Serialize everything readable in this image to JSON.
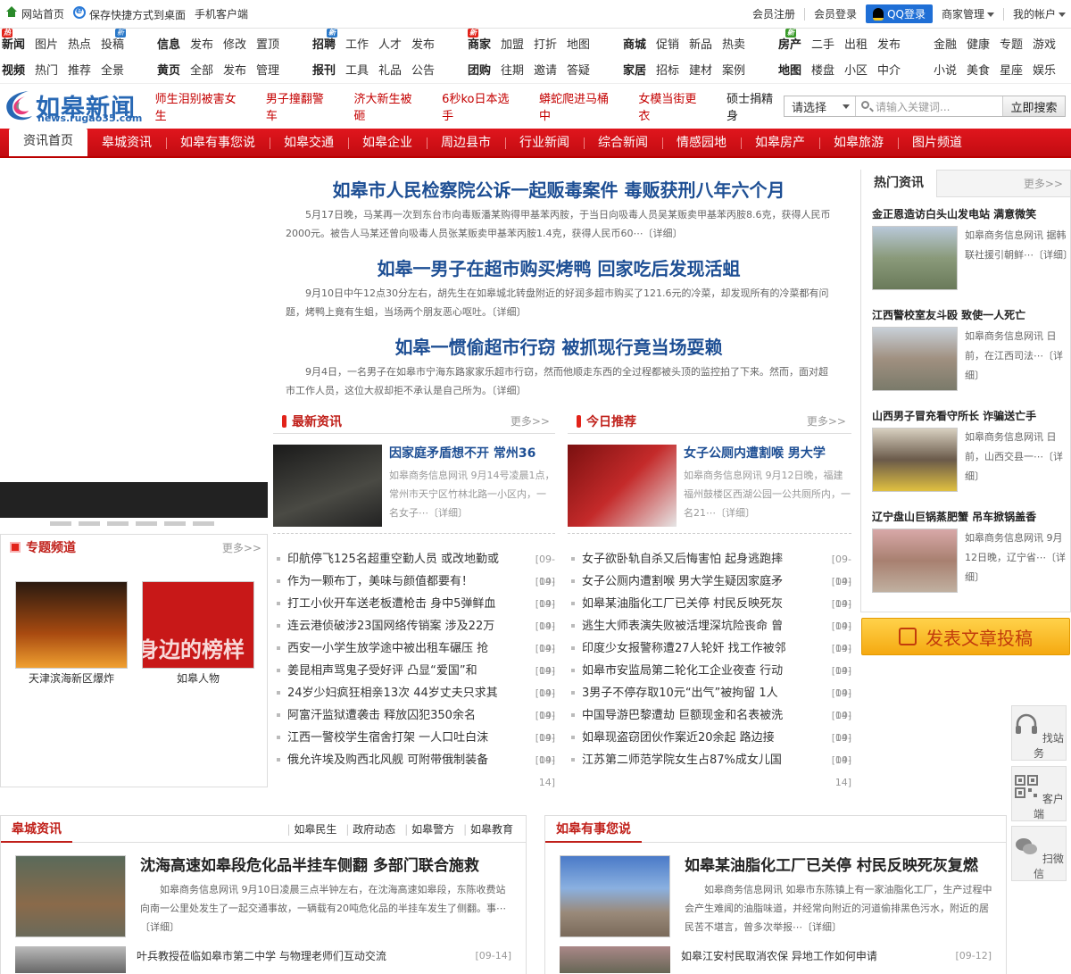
{
  "topbar": {
    "left": [
      "网站首页",
      "保存快捷方式到桌面",
      "手机客户端"
    ],
    "right": [
      "会员注册",
      "会员登录",
      "QQ登录",
      "商家管理",
      "我的帐户"
    ]
  },
  "nav": {
    "groups": [
      {
        "cols": 4,
        "items": [
          {
            "t": "新闻",
            "b": true,
            "badge": "热"
          },
          {
            "t": "图片"
          },
          {
            "t": "热点"
          },
          {
            "t": "投稿",
            "badge": "新",
            "badgeColor": "blue"
          },
          {
            "t": "视频",
            "b": true
          },
          {
            "t": "热门"
          },
          {
            "t": "推荐"
          },
          {
            "t": "全景"
          }
        ]
      },
      {
        "cols": 4,
        "items": [
          {
            "t": "信息",
            "b": true
          },
          {
            "t": "发布"
          },
          {
            "t": "修改"
          },
          {
            "t": "置顶"
          },
          {
            "t": "黄页",
            "b": true
          },
          {
            "t": "全部"
          },
          {
            "t": "发布"
          },
          {
            "t": "管理"
          }
        ]
      },
      {
        "cols": 4,
        "items": [
          {
            "t": "招聘",
            "b": true,
            "badge": "新",
            "badgeColor": "blue"
          },
          {
            "t": "工作"
          },
          {
            "t": "人才"
          },
          {
            "t": "发布"
          },
          {
            "t": "报刊",
            "b": true
          },
          {
            "t": "工具"
          },
          {
            "t": "礼品"
          },
          {
            "t": "公告"
          }
        ]
      },
      {
        "cols": 4,
        "items": [
          {
            "t": "商家",
            "b": true,
            "badge": "新"
          },
          {
            "t": "加盟"
          },
          {
            "t": "打折"
          },
          {
            "t": "地图"
          },
          {
            "t": "团购",
            "b": true
          },
          {
            "t": "往期"
          },
          {
            "t": "邀请"
          },
          {
            "t": "答疑"
          }
        ]
      },
      {
        "cols": 4,
        "items": [
          {
            "t": "商城",
            "b": true
          },
          {
            "t": "促销"
          },
          {
            "t": "新品"
          },
          {
            "t": "热卖"
          },
          {
            "t": "家居",
            "b": true
          },
          {
            "t": "招标"
          },
          {
            "t": "建材"
          },
          {
            "t": "案例"
          }
        ]
      },
      {
        "cols": 4,
        "items": [
          {
            "t": "房产",
            "b": true,
            "badge": "新",
            "badgeColor": "green"
          },
          {
            "t": "二手"
          },
          {
            "t": "出租"
          },
          {
            "t": "发布"
          },
          {
            "t": "地图",
            "b": true
          },
          {
            "t": "楼盘"
          },
          {
            "t": "小区"
          },
          {
            "t": "中介"
          }
        ]
      },
      {
        "cols": 4,
        "items": [
          {
            "t": "金融"
          },
          {
            "t": "健康"
          },
          {
            "t": "专题"
          },
          {
            "t": "游戏"
          },
          {
            "t": "小说"
          },
          {
            "t": "美食"
          },
          {
            "t": "星座"
          },
          {
            "t": "娱乐"
          }
        ]
      }
    ]
  },
  "logo": {
    "name": "如皋新闻",
    "url": "news.rugao35.com"
  },
  "hotlinks": [
    {
      "t": "师生泪别被害女生"
    },
    {
      "t": "男子撞翻警车"
    },
    {
      "t": "济大新生被砸"
    },
    {
      "t": "6秒ko日本选手"
    },
    {
      "t": "蟒蛇爬进马桶中"
    },
    {
      "t": "女模当街更衣"
    },
    {
      "t": "硕士捐精身",
      "dark": true
    }
  ],
  "search": {
    "select": "请选择",
    "placeholder": "请输入关键词...",
    "button": "立即搜索"
  },
  "channels": [
    "资讯首页",
    "皋城资讯",
    "如皋有事您说",
    "如皋交通",
    "如皋企业",
    "周边县市",
    "行业新闻",
    "综合新闻",
    "情感园地",
    "如皋房产",
    "如皋旅游",
    "图片频道"
  ],
  "headlines": [
    {
      "title": "如皋市人民检察院公诉一起贩毒案件 毒贩获刑八年六个月",
      "summary": "5月17日晚，马某再一次到东台市向毒贩潘某购得甲基苯丙胺，于当日向吸毒人员吴某贩卖甲基苯丙胺8.6克，获得人民币2000元。被告人马某还曾向吸毒人员张某贩卖甲基苯丙胺1.4克，获得人民币60⋯〔详细〕"
    },
    {
      "title": "如皋一男子在超市购买烤鸭 回家吃后发现活蛆",
      "summary": "9月10日中午12点30分左右，胡先生在如皋城北转盘附近的好润多超市购买了121.6元的冷菜，却发现所有的冷菜都有问题，烤鸭上竟有生蛆，当场两个朋友恶心呕吐。〔详细〕"
    },
    {
      "title": "如皋一惯偷超市行窃 被抓现行竟当场耍赖",
      "summary": "9月4日，一名男子在如皋市宁海东路家家乐超市行窃，然而他顺走东西的全过程都被头顶的监控拍了下来。然而，面对超市工作人员，这位大叔却拒不承认是自己所为。〔详细〕"
    }
  ],
  "latest": {
    "title": "最新资讯",
    "more": "更多>>",
    "feature": {
      "title": "因家庭矛盾想不开 常州36",
      "summary": "如皋商务信息网讯 9月14号凌晨1点，常州市天宁区竹林北路一小区内，一名女子⋯〔详细〕"
    },
    "items": [
      {
        "t": "印航停飞125名超重空勤人员 或改地勤或",
        "d": "[09-14]"
      },
      {
        "t": "作为一颗布丁，美味与颜值都要有！",
        "d": "[09-14]"
      },
      {
        "t": "打工小伙开车送老板遭枪击 身中5弹鲜血",
        "d": "[09-14]"
      },
      {
        "t": "连云港侦破涉23国网络传销案 涉及22万",
        "d": "[09-14]"
      },
      {
        "t": "西安一小学生放学途中被出租车碾压 抢",
        "d": "[09-14]"
      },
      {
        "t": "姜昆相声骂鬼子受好评 凸显“爱国”和",
        "d": "[09-14]"
      },
      {
        "t": "24岁少妇疯狂相亲13次 44岁丈夫只求其",
        "d": "[09-14]"
      },
      {
        "t": "阿富汗监狱遭袭击 释放囚犯350余名",
        "d": "[09-14]"
      },
      {
        "t": "江西一警校学生宿舍打架 一人口吐白沫",
        "d": "[09-14]"
      },
      {
        "t": "俄允许埃及购西北风舰 可附带俄制装备",
        "d": "[09-14]"
      }
    ]
  },
  "today": {
    "title": "今日推荐",
    "more": "更多>>",
    "feature": {
      "title": "女子公厕内遭割喉 男大学",
      "summary": "如皋商务信息网讯 9月12日晚，福建福州鼓楼区西湖公园一公共厕所内，一名21⋯〔详细〕"
    },
    "items": [
      {
        "t": "女子欲卧轨自杀又后悔害怕 起身逃跑摔",
        "d": "[09-14]"
      },
      {
        "t": "女子公厕内遭割喉 男大学生疑因家庭矛",
        "d": "[09-14]"
      },
      {
        "t": "如皋某油脂化工厂已关停 村民反映死灰",
        "d": "[09-14]"
      },
      {
        "t": "逃生大师表演失败被活埋深坑险丧命 曾",
        "d": "[09-14]"
      },
      {
        "t": "印度少女报警称遭27人轮奸 找工作被邻",
        "d": "[09-14]"
      },
      {
        "t": "如皋市安监局第二轮化工企业夜查 行动",
        "d": "[09-14]"
      },
      {
        "t": "3男子不停存取10元“出气”被拘留 1人",
        "d": "[09-14]"
      },
      {
        "t": "中国导游巴黎遭劫 巨额现金和名表被洗",
        "d": "[09-14]"
      },
      {
        "t": "如皋现盗窃团伙作案近20余起  路边接",
        "d": "[09-14]"
      },
      {
        "t": "江苏第二师范学院女生占87%成女儿国",
        "d": "[09-14]"
      }
    ]
  },
  "topics": {
    "title": "专题频道",
    "more": "更多>>",
    "cards": [
      {
        "label": "天津滨海新区爆炸"
      },
      {
        "label": "如皋人物",
        "overlay": "身边的榜样"
      }
    ]
  },
  "hot": {
    "title": "热门资讯",
    "more": "更多>>",
    "items": [
      {
        "title": "金正恩造访白头山发电站 满意微笑",
        "summary": "如皋商务信息网讯 据韩联社援引朝鲜⋯〔详细〕"
      },
      {
        "title": "江西警校室友斗殴 致使一人死亡",
        "summary": "如皋商务信息网讯 日前，在江西司法⋯〔详细〕"
      },
      {
        "title": "山西男子冒充看守所长 诈骗送亡手",
        "summary": "如皋商务信息网讯 日前，山西交县一⋯〔详细〕"
      },
      {
        "title": "辽宁盘山巨锅蒸肥蟹 吊车掀锅盖香",
        "summary": "如皋商务信息网讯 9月12日晚，辽宁省⋯〔详细〕"
      }
    ]
  },
  "post_button": "发表文章投稿",
  "floats": [
    {
      "label": "找站务"
    },
    {
      "label": "客户端"
    },
    {
      "label": "扫微信"
    }
  ],
  "gaocheng": {
    "title": "皋城资讯",
    "tabs": [
      "如皋民生",
      "政府动态",
      "如皋警方",
      "如皋教育"
    ],
    "feature": {
      "title": "沈海高速如皋段危化品半挂车侧翻 多部门联合施救",
      "summary": "如皋商务信息网讯 9月10日凌晨三点半钟左右，在沈海高速如皋段，东陈收费站向南一公里处发生了一起交通事故，一辆载有20吨危化品的半挂车发生了侧翻。事⋯〔详细〕"
    },
    "list": [
      {
        "t": "叶兵教授莅临如皋市第二中学 与物理老师们互动交流",
        "d": "[09-14]"
      }
    ]
  },
  "youshi": {
    "title": "如皋有事您说",
    "feature": {
      "title": "如皋某油脂化工厂已关停 村民反映死灰复燃",
      "summary": "如皋商务信息网讯 如皋市东陈镇上有一家油脂化工厂，生产过程中会产生难闻的油脂味道，并经常向附近的河道偷排黑色污水，附近的居民苦不堪言，曾多次举报⋯〔详细〕"
    },
    "list": [
      {
        "t": "如皋江安村民取消农保 异地工作如何申请",
        "d": "[09-12]"
      }
    ]
  }
}
